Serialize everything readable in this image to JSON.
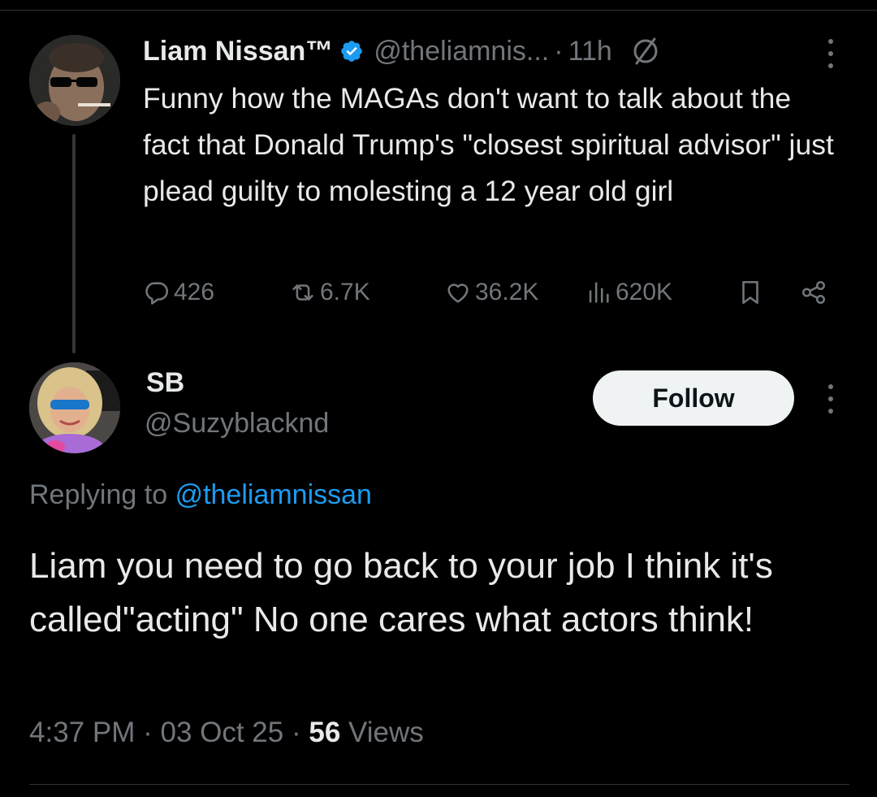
{
  "parent_tweet": {
    "author_name": "Liam Nissan™",
    "handle": "@theliamnis...",
    "separator": "·",
    "time_ago": "11h",
    "text": "Funny how the MAGAs don't want to talk about the fact that Donald Trump's \"closest spiritual advisor\" just plead guilty to molesting a 12 year old girl",
    "stats": {
      "replies": "426",
      "reposts": "6.7K",
      "likes": "36.2K",
      "views": "620K"
    },
    "icons": [
      "verified-badge-icon",
      "grok-icon",
      "more-icon",
      "reply-icon",
      "repost-icon",
      "like-icon",
      "views-icon",
      "bookmark-icon",
      "share-icon"
    ]
  },
  "reply_tweet": {
    "author_name": "SB",
    "handle": "@Suzyblacknd",
    "follow_label": "Follow",
    "replying_prefix": "Replying to",
    "replying_mention": "@theliamnissan",
    "text": "Liam you need to go back to your job I think it's called\"acting\" No one cares what actors think!",
    "time": "4:37 PM",
    "date": "03 Oct 25",
    "separator": "·",
    "views_count": "56",
    "views_label": "Views"
  },
  "colors": {
    "background": "#000000",
    "text_primary": "#e7e9ea",
    "text_secondary": "#71767b",
    "accent_blue": "#1d9bf0",
    "button_bg": "#eff3f4"
  }
}
